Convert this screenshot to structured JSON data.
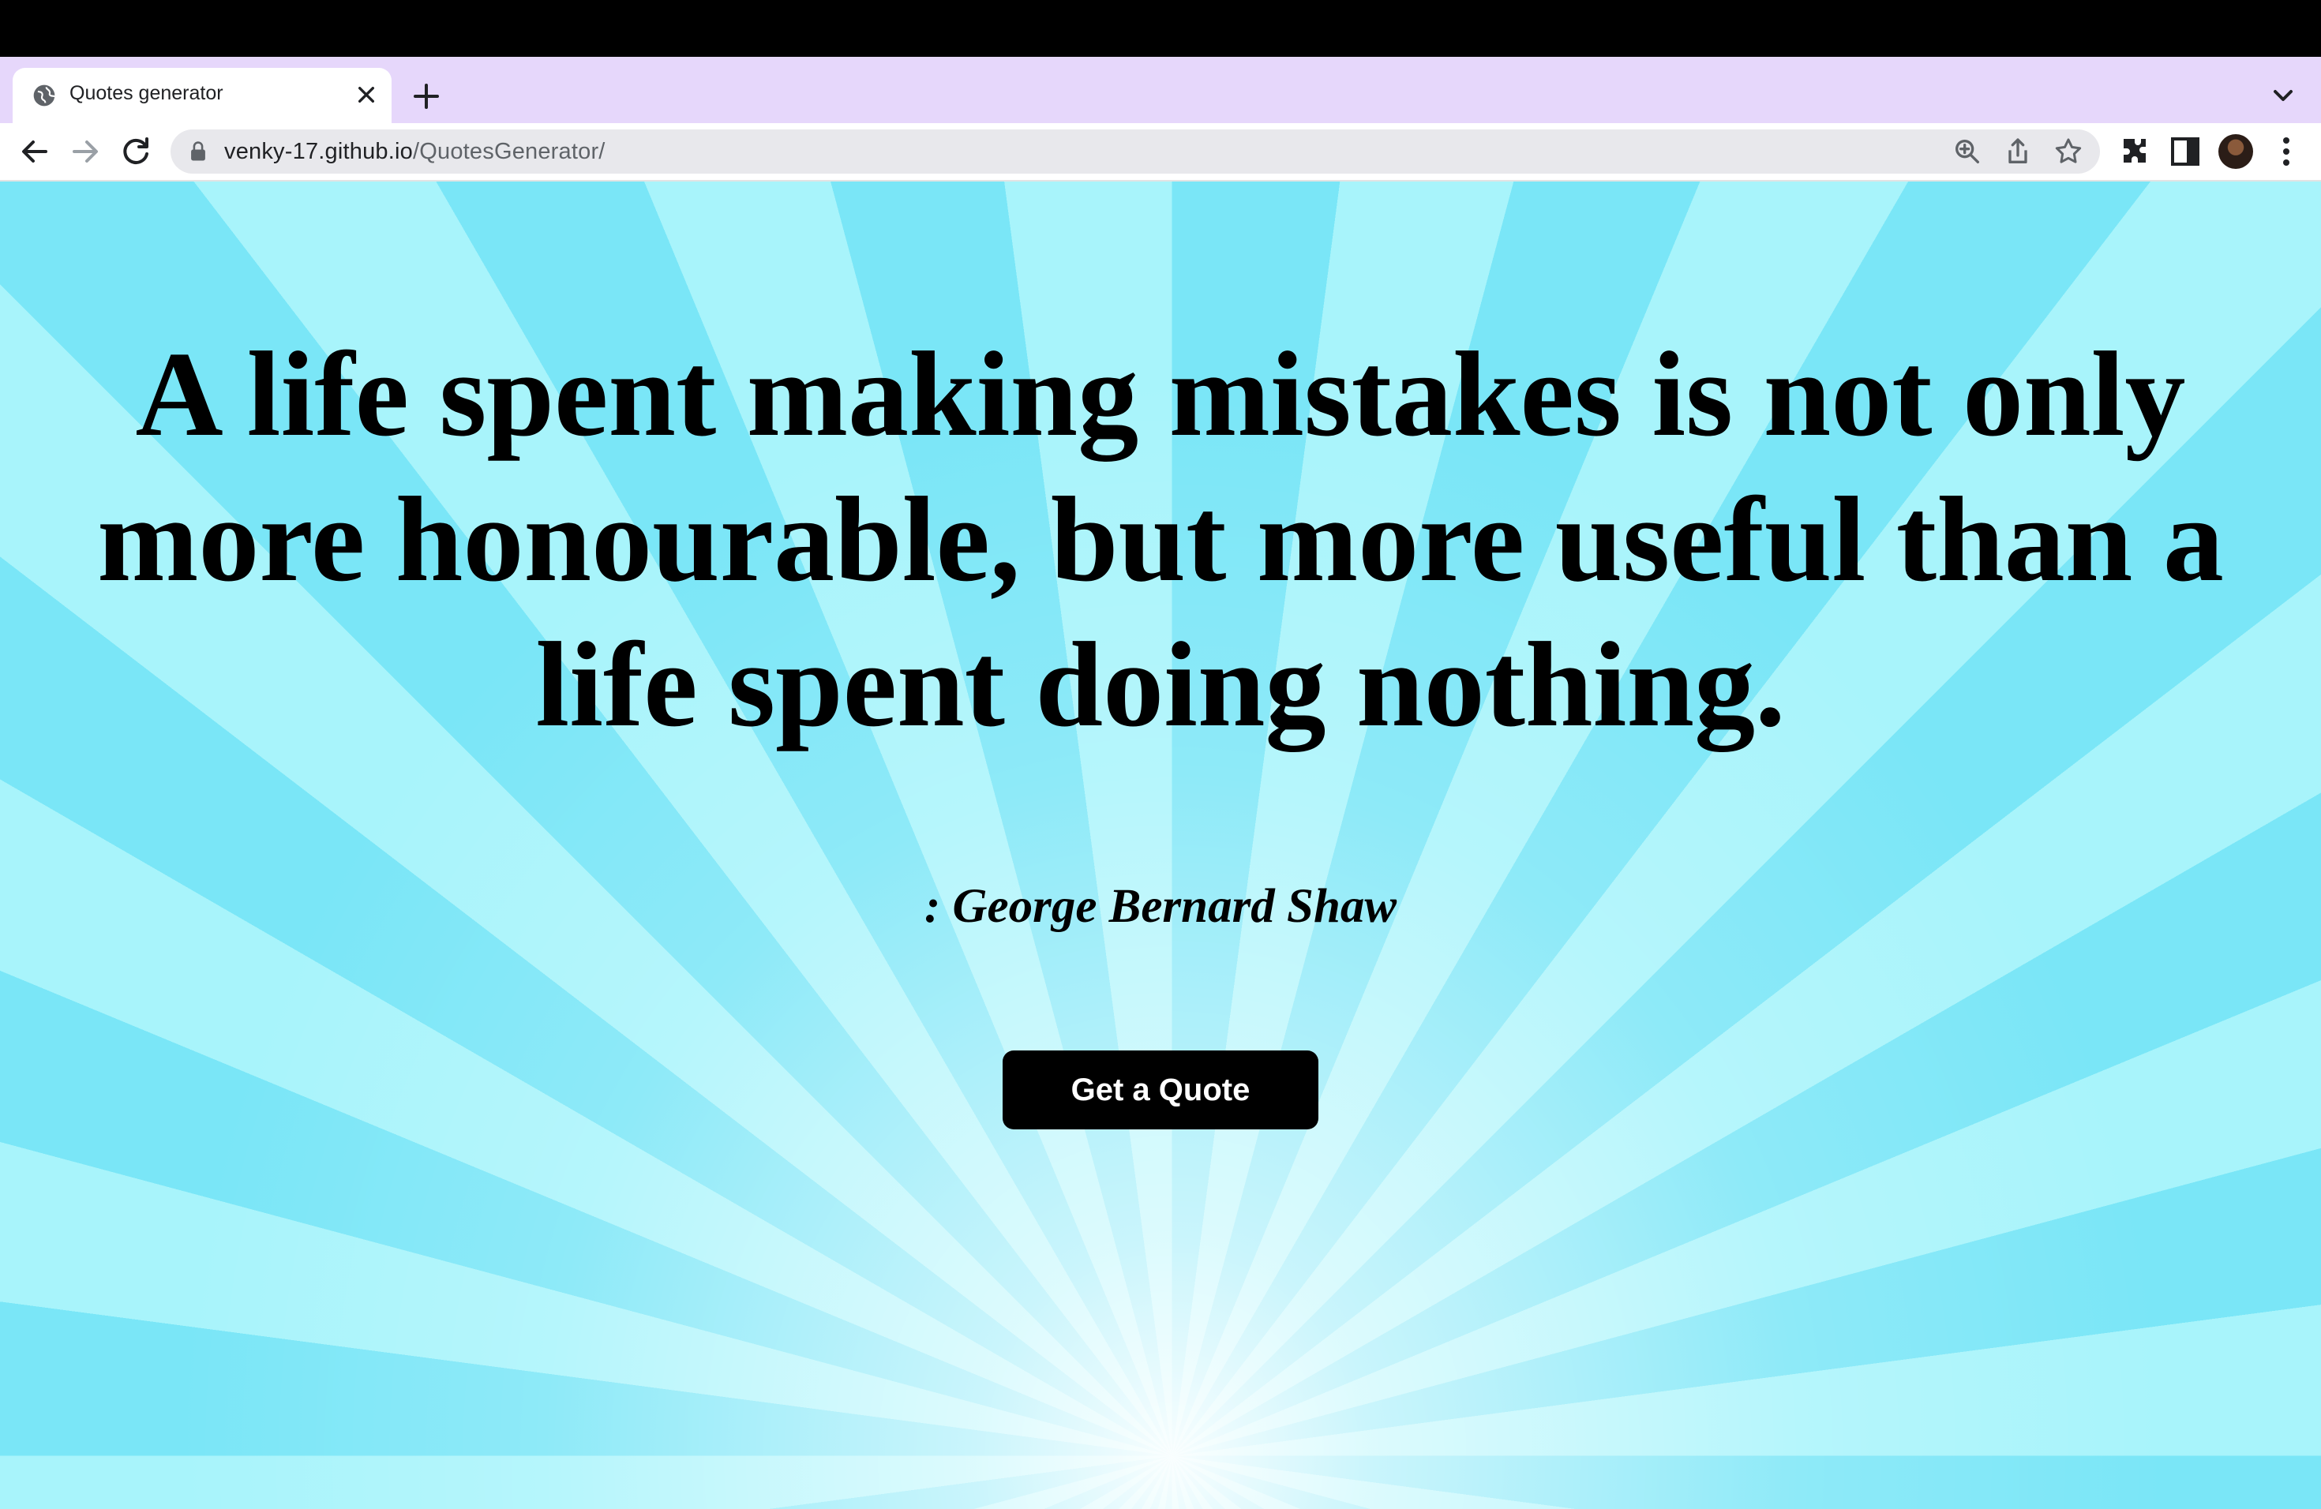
{
  "browser": {
    "tab_title": "Quotes generator",
    "url_host": "venky-17.github.io",
    "url_path": "/QuotesGenerator/"
  },
  "icons": {
    "tab": "globe-icon",
    "close": "close-icon",
    "new_tab": "plus-icon",
    "tab_search": "chevron-down-icon",
    "back": "back-arrow-icon",
    "forward": "forward-arrow-icon",
    "reload": "reload-icon",
    "lock": "lock-icon",
    "zoom": "zoom-icon",
    "share": "share-icon",
    "bookmark": "star-icon",
    "extensions": "puzzle-icon",
    "side_panel": "side-panel-icon",
    "menu": "kebab-menu-icon"
  },
  "page": {
    "quote": "A life spent making mistakes is not only more honourable, but more useful than a life spent doing nothing.",
    "author": ": George Bernard Shaw",
    "button_label": "Get a Quote"
  },
  "colors": {
    "tab_strip": "#e6d7fb",
    "ray_dark": "#7ae6f7",
    "ray_light": "#a8f4fb",
    "button_bg": "#000000",
    "button_text": "#ffffff"
  }
}
